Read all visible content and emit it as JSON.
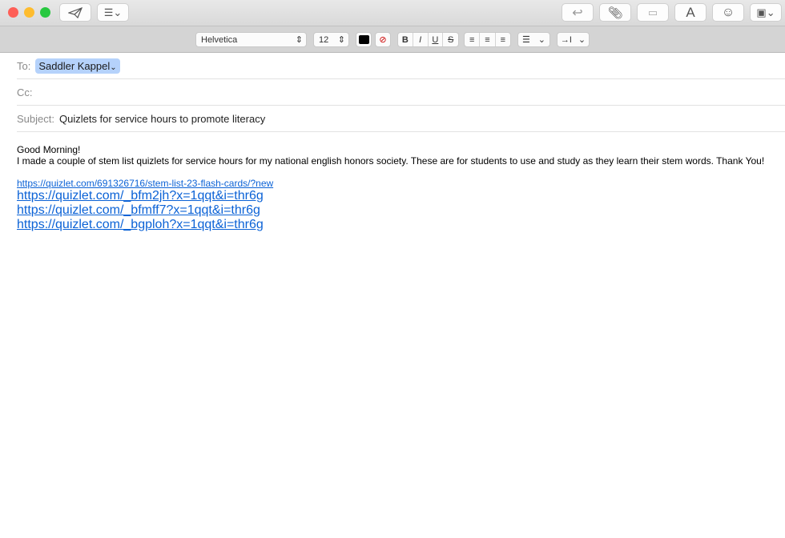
{
  "toolbar": {
    "font": "Helvetica",
    "size": "12",
    "bold": "B",
    "italic": "I",
    "underline": "U",
    "strike": "S",
    "indent": "→I",
    "font_style": "A"
  },
  "header": {
    "to_label": "To:",
    "to_recipient": "Saddler Kappel",
    "cc_label": "Cc:",
    "subject_label": "Subject:",
    "subject": "Quizlets for service hours to promote literacy"
  },
  "body": {
    "greeting": "Good Morning!",
    "message": "I made a couple of stem list quizlets for service hours for my national english honors society. These are for students to use and study as they learn their stem words. Thank You!",
    "links": [
      "https://quizlet.com/691326716/stem-list-23-flash-cards/?new",
      "https://quizlet.com/_bfm2jh?x=1qqt&i=thr6g",
      "https://quizlet.com/_bfmff7?x=1qqt&i=thr6g",
      "https://quizlet.com/_bgploh?x=1qqt&i=thr6g"
    ]
  }
}
